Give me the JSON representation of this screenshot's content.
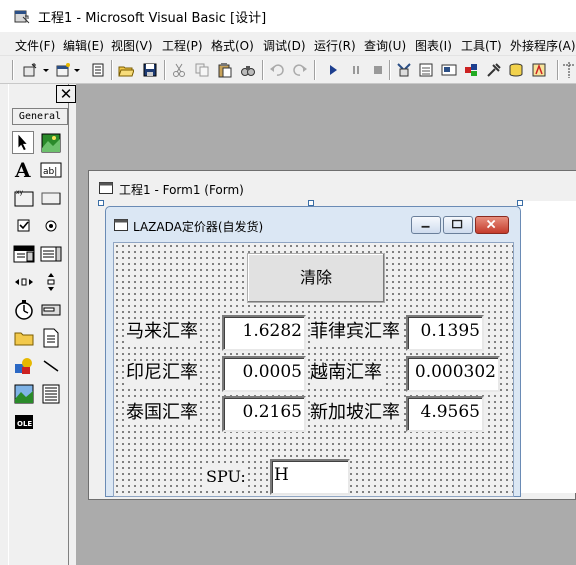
{
  "app": {
    "title": "工程1 - Microsoft Visual Basic [设计]"
  },
  "menu": [
    {
      "label": "文件(F)"
    },
    {
      "label": "编辑(E)"
    },
    {
      "label": "视图(V)"
    },
    {
      "label": "工程(P)"
    },
    {
      "label": "格式(O)"
    },
    {
      "label": "调试(D)"
    },
    {
      "label": "运行(R)"
    },
    {
      "label": "查询(U)"
    },
    {
      "label": "图表(I)"
    },
    {
      "label": "工具(T)"
    },
    {
      "label": "外接程序(A)"
    }
  ],
  "toolbox": {
    "close_label": "✕",
    "tab_label": "General"
  },
  "form_window": {
    "title": "工程1 - Form1 (Form)"
  },
  "lazada_form": {
    "title": "LAZADA定价器(自发货)",
    "clear_button": "清除",
    "rates": {
      "myr_label": "马来汇率",
      "myr_value": "1.6282",
      "php_label": "菲律宾汇率",
      "php_value": "0.1395",
      "idr_label": "印尼汇率",
      "idr_value": "0.0005",
      "vnd_label": "越南汇率",
      "vnd_value": "0.000302",
      "thb_label": "泰国汇率",
      "thb_value": "0.2165",
      "sgd_label": "新加坡汇率",
      "sgd_value": "4.9565"
    },
    "spu_label": "SPU:",
    "spu_value": "H"
  },
  "colors": {
    "designer_bg": "#ababab",
    "form_title_bg": "#dbe7f4",
    "close_red": "#c9463d"
  },
  "icons": [
    "vb-project-icon",
    "add-form-icon",
    "open-icon",
    "save-icon",
    "cut-icon",
    "copy-icon",
    "paste-icon",
    "find-icon",
    "undo-icon",
    "redo-icon",
    "run-icon",
    "pause-icon",
    "stop-icon",
    "pointer-icon",
    "picturebox-icon",
    "label-icon",
    "textbox-icon",
    "frame-icon",
    "commandbutton-icon",
    "checkbox-icon",
    "optionbutton-icon",
    "combobox-icon",
    "listbox-icon",
    "hscrollbar-icon",
    "vscrollbar-icon",
    "timer-icon",
    "drivelistbox-icon",
    "dirlistbox-icon",
    "filelistbox-icon",
    "shape-icon",
    "line-icon",
    "image-icon",
    "data-icon",
    "ole-icon"
  ]
}
